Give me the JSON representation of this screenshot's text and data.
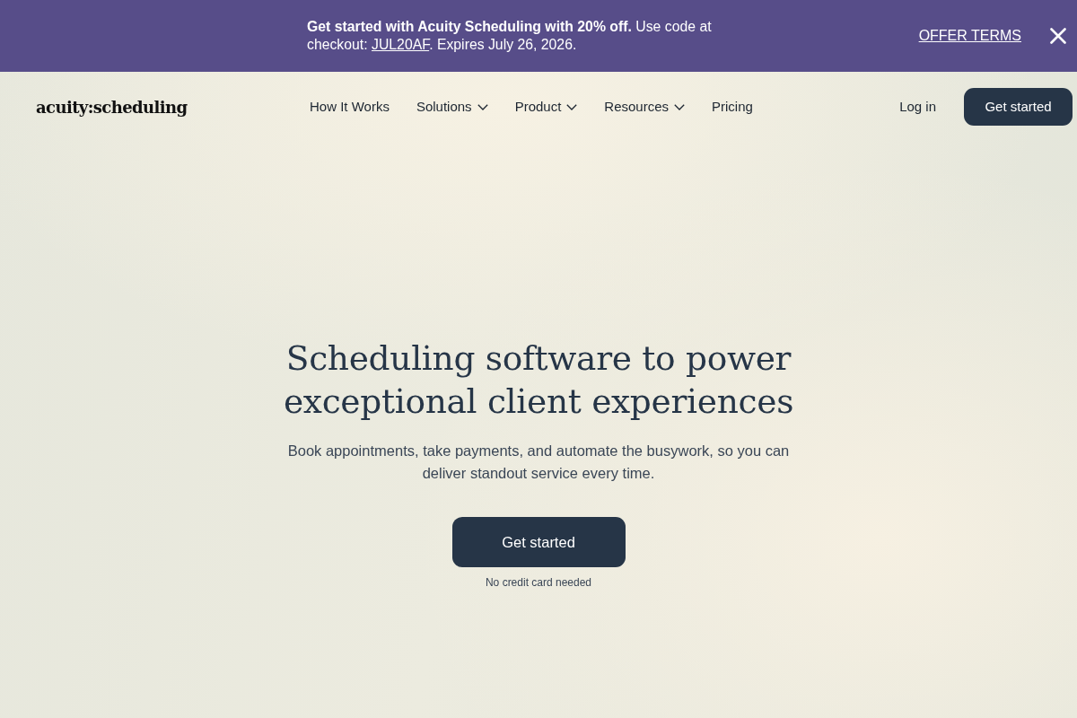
{
  "promo_banner": {
    "message_start": "**Get started with Acuity Scheduling with 20% off.** Use code at checkout: ",
    "promo_code": "JUL20AF",
    "message_end": ". Expires July 26, 2026.",
    "terms_link": "OFFER TERMS"
  },
  "header": {
    "logo": "acuity:scheduling",
    "nav": [
      {
        "label": "How It Works",
        "has_menu": false
      },
      {
        "label": "Solutions",
        "has_menu": true
      },
      {
        "label": "Product",
        "has_menu": true
      },
      {
        "label": "Resources",
        "has_menu": true
      },
      {
        "label": "Pricing",
        "has_menu": false
      }
    ],
    "login": "Log in",
    "cta": "Get started"
  },
  "hero": {
    "heading": "Scheduling software to power exceptional client experiences",
    "subheading": "Book appointments, take payments, and automate the busywork, so you can deliver standout service every time.",
    "cta": "Get started",
    "note": "No credit card needed"
  }
}
